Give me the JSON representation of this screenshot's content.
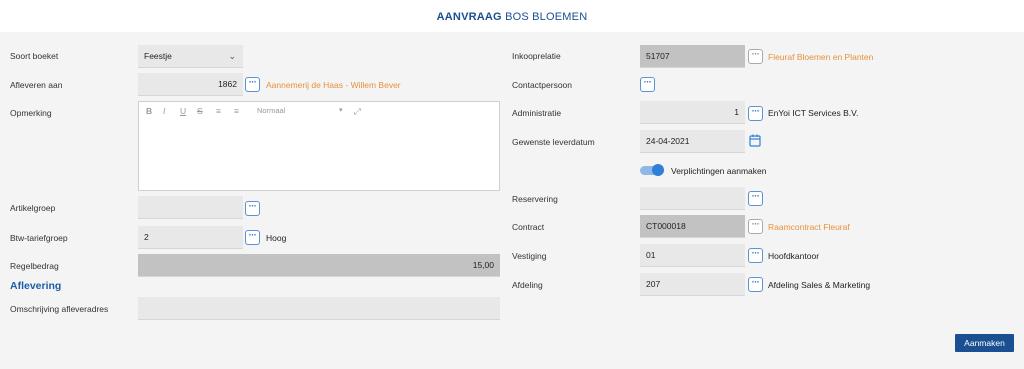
{
  "header": {
    "title_bold": "AANVRAAG",
    "title_light": "BOS BLOEMEN"
  },
  "left": {
    "soort_boeket": {
      "label": "Soort boeket",
      "value": "Feestje"
    },
    "afleveren_aan": {
      "label": "Afleveren aan",
      "value": "1862",
      "link": "Aannemerij de Haas - Willem Bever"
    },
    "opmerking": {
      "label": "Opmerking",
      "toolbar_style": "Normaal"
    },
    "artikelgroep": {
      "label": "Artikelgroep",
      "value": ""
    },
    "btw": {
      "label": "Btw-tariefgroep",
      "value": "2",
      "desc": "Hoog"
    },
    "regelbedrag": {
      "label": "Regelbedrag",
      "value": "15,00"
    },
    "aflevering_title": "Aflevering",
    "omschrijving": {
      "label": "Omschrijving afleveradres",
      "value": ""
    }
  },
  "right": {
    "inkooprelatie": {
      "label": "Inkooprelatie",
      "value": "51707",
      "link": "Fleuraf Bloemen en Planten"
    },
    "contactpersoon": {
      "label": "Contactpersoon"
    },
    "administratie": {
      "label": "Administratie",
      "value": "1",
      "desc": "EnYoi ICT Services B.V."
    },
    "leverdatum": {
      "label": "Gewenste leverdatum",
      "value": "24-04-2021"
    },
    "verplichtingen": {
      "label": "Verplichtingen aanmaken",
      "on": true
    },
    "reservering": {
      "label": "Reservering",
      "value": ""
    },
    "contract": {
      "label": "Contract",
      "value": "CT000018",
      "link": "Raamcontract Fleuraf"
    },
    "vestiging": {
      "label": "Vestiging",
      "value": "01",
      "desc": "Hoofdkantoor"
    },
    "afdeling": {
      "label": "Afdeling",
      "value": "207",
      "desc": "Afdeling Sales & Marketing"
    }
  },
  "actions": {
    "create_label": "Aanmaken"
  },
  "colors": {
    "brand": "#1a4f91",
    "link": "#e8913a",
    "accent": "#2f80d6"
  }
}
